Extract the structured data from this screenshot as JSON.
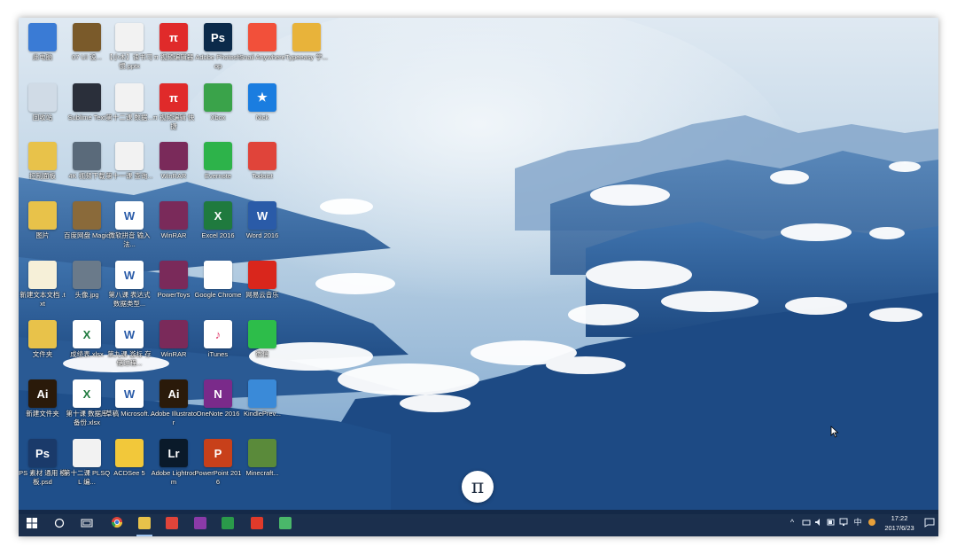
{
  "desktop": {
    "icons": [
      {
        "label": "此电脑",
        "icon": "this-pc-icon",
        "color": "#3a7bd5",
        "glyph": ""
      },
      {
        "label": "07 UI 设...",
        "icon": "grid-image-icon",
        "color": "#7a5a2a",
        "glyph": ""
      },
      {
        "label": "【小木】读书习惯.pptx",
        "icon": "pdf-file-icon",
        "color": "#f2f2f2",
        "glyph": ""
      },
      {
        "label": "π 视频编辑器",
        "icon": "pi-app-icon",
        "color": "#e02a2a",
        "glyph": "π"
      },
      {
        "label": "Adobe Photoshop",
        "icon": "photoshop-icon",
        "color": "#0b2a4a",
        "glyph": "Ps"
      },
      {
        "label": "Snail Anywhere",
        "icon": "snail-app-icon",
        "color": "#f2503a",
        "glyph": ""
      },
      {
        "label": "Typeeasy 学...",
        "icon": "typeeasy-icon",
        "color": "#e8b33a",
        "glyph": ""
      },
      {
        "label": "回收站",
        "icon": "recycle-bin-icon",
        "color": "#d0dbe6",
        "glyph": ""
      },
      {
        "label": "Sublime Text",
        "icon": "sublime-text-icon",
        "color": "#2a2f3a",
        "glyph": ""
      },
      {
        "label": "第十二课 数据...",
        "icon": "pdf-file-icon",
        "color": "#f2f2f2",
        "glyph": ""
      },
      {
        "label": "π 视频编辑 快捷",
        "icon": "pi-app-icon",
        "color": "#e02a2a",
        "glyph": "π"
      },
      {
        "label": "Xbox",
        "icon": "xbox-icon",
        "color": "#3aa34a",
        "glyph": ""
      },
      {
        "label": "Nick",
        "icon": "star-app-icon",
        "color": "#1a7de0",
        "glyph": "★"
      },
      {
        "label": "控制面板",
        "icon": "folder-yellow-icon",
        "color": "#e8c24a",
        "glyph": ""
      },
      {
        "label": "4K 视频下载",
        "icon": "video-folder-icon",
        "color": "#5a6a7a",
        "glyph": ""
      },
      {
        "label": "第十一课 查询...",
        "icon": "pdf-file-icon",
        "color": "#f2f2f2",
        "glyph": ""
      },
      {
        "label": "WinRAR",
        "icon": "winrar-icon",
        "color": "#7a2a5a",
        "glyph": ""
      },
      {
        "label": "Evernote",
        "icon": "evernote-icon",
        "color": "#2db34a",
        "glyph": ""
      },
      {
        "label": "Todoist",
        "icon": "todoist-icon",
        "color": "#e0443a",
        "glyph": ""
      },
      {
        "label": "图片",
        "icon": "folder-yellow-icon",
        "color": "#e8c24a",
        "glyph": ""
      },
      {
        "label": "百度网盘 Magic",
        "icon": "archive-icon",
        "color": "#8a6a3a",
        "glyph": ""
      },
      {
        "label": "微软拼音 输入法...",
        "icon": "word-doc-icon",
        "color": "#ffffff",
        "glyph": "W"
      },
      {
        "label": "WinRAR",
        "icon": "winrar-icon",
        "color": "#7a2a5a",
        "glyph": ""
      },
      {
        "label": "Excel 2016",
        "icon": "excel-icon",
        "color": "#1f7a3e",
        "glyph": "X"
      },
      {
        "label": "Word 2016",
        "icon": "word-icon",
        "color": "#2a5ba8",
        "glyph": "W"
      },
      {
        "label": "新建文本文档 .txt",
        "icon": "text-file-icon",
        "color": "#f6f0d8",
        "glyph": ""
      },
      {
        "label": "头像.jpg",
        "icon": "image-file-icon",
        "color": "#6a7a8a",
        "glyph": ""
      },
      {
        "label": "第八课 表达式 数据类型...",
        "icon": "word-doc-icon",
        "color": "#ffffff",
        "glyph": "W"
      },
      {
        "label": "PowerToys",
        "icon": "winrar-icon",
        "color": "#7a2a5a",
        "glyph": ""
      },
      {
        "label": "Google Chrome",
        "icon": "chrome-icon",
        "color": "#ffffff",
        "glyph": ""
      },
      {
        "label": "网易云音乐",
        "icon": "netease-music-icon",
        "color": "#d9261c",
        "glyph": ""
      },
      {
        "label": "文件夹",
        "icon": "folder-yellow-icon",
        "color": "#e8c24a",
        "glyph": ""
      },
      {
        "label": "成绩表.xlsx",
        "icon": "excel-doc-icon",
        "color": "#ffffff",
        "glyph": "X"
      },
      {
        "label": "第九课 游标 存储过程...",
        "icon": "word-doc-icon",
        "color": "#ffffff",
        "glyph": "W"
      },
      {
        "label": "WinRAR",
        "icon": "winrar-icon",
        "color": "#7a2a5a",
        "glyph": ""
      },
      {
        "label": "iTunes",
        "icon": "itunes-icon",
        "color": "#ffffff",
        "glyph": "♪"
      },
      {
        "label": "微信",
        "icon": "wechat-icon",
        "color": "#2dbd4a",
        "glyph": ""
      },
      {
        "label": "新建文件夹",
        "icon": "illustrator-file-icon",
        "color": "#2a1a0a",
        "glyph": "Ai"
      },
      {
        "label": "第十课 数据库 备份.xlsx",
        "icon": "excel-doc-icon",
        "color": "#ffffff",
        "glyph": "X"
      },
      {
        "label": "草稿 Microsoft...",
        "icon": "word-doc-icon",
        "color": "#ffffff",
        "glyph": "W"
      },
      {
        "label": "Adobe Illustrator",
        "icon": "illustrator-icon",
        "color": "#2a1a0a",
        "glyph": "Ai"
      },
      {
        "label": "OneNote 2016",
        "icon": "onenote-icon",
        "color": "#7a2a8a",
        "glyph": "N"
      },
      {
        "label": "KindlePrev...",
        "icon": "kindle-icon",
        "color": "#3a8ad8",
        "glyph": ""
      },
      {
        "label": "PS 素材 通用 模板.psd",
        "icon": "photoshop-file-icon",
        "color": "#1a3a6a",
        "glyph": "Ps"
      },
      {
        "label": "第十二课 PLSQL 编...",
        "icon": "pdf-file-icon",
        "color": "#f2f2f2",
        "glyph": ""
      },
      {
        "label": "ACDSee 5",
        "icon": "acdsee-icon",
        "color": "#f2c83a",
        "glyph": ""
      },
      {
        "label": "Adobe Lightroom",
        "icon": "lightroom-icon",
        "color": "#0a1a2a",
        "glyph": "Lr"
      },
      {
        "label": "PowerPoint 2016",
        "icon": "powerpoint-icon",
        "color": "#c8401a",
        "glyph": "P"
      },
      {
        "label": "Minecraft...",
        "icon": "minecraft-icon",
        "color": "#5a8a3a",
        "glyph": ""
      }
    ]
  },
  "floating_button": {
    "glyph": "π",
    "icon": "pi-floating-icon"
  },
  "taskbar": {
    "apps": [
      {
        "icon": "windows-start-icon",
        "name": "start-button",
        "color": "#ffffff"
      },
      {
        "icon": "cortana-search-icon",
        "name": "search-button",
        "color": "#ffffff"
      },
      {
        "icon": "task-view-icon",
        "name": "task-view-button",
        "color": "#ffffff"
      },
      {
        "icon": "chrome-icon",
        "name": "taskbar-chrome",
        "color": "#e8b33a"
      },
      {
        "icon": "file-explorer-icon",
        "name": "taskbar-file-explorer",
        "color": "#e8c24a"
      },
      {
        "icon": "red-app-icon",
        "name": "taskbar-app-red",
        "color": "#e0443a"
      },
      {
        "icon": "onenote-icon",
        "name": "taskbar-onenote",
        "color": "#8a3aa8"
      },
      {
        "icon": "excel-icon",
        "name": "taskbar-excel",
        "color": "#2a9a4a"
      },
      {
        "icon": "netease-music-icon",
        "name": "taskbar-netease",
        "color": "#e03a2a"
      },
      {
        "icon": "green-app-icon",
        "name": "taskbar-app-green",
        "color": "#4ab86a"
      }
    ],
    "tray": {
      "chevron": "^",
      "ime": "中",
      "time": "17:22",
      "date": "2017/6/23"
    }
  }
}
